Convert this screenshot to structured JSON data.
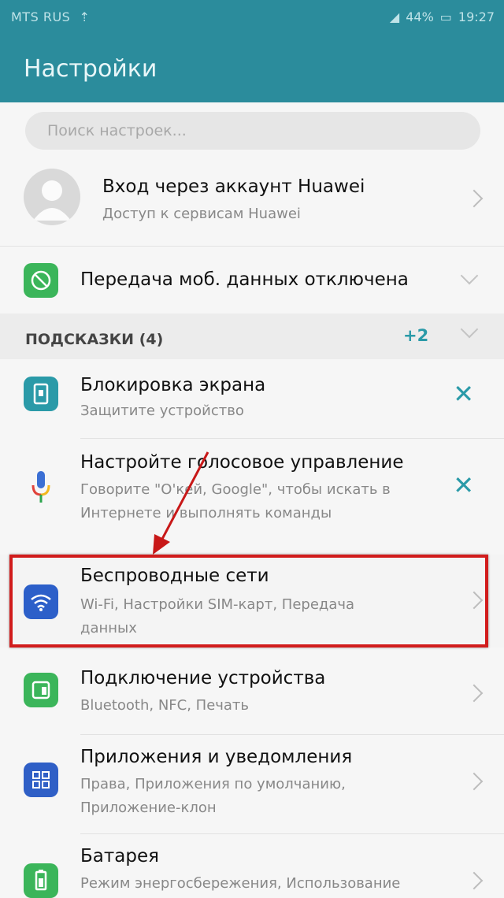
{
  "status": {
    "carrier": "MTS RUS",
    "battery": "44%",
    "time": "19:27"
  },
  "appbar": {
    "title": "Настройки"
  },
  "search": {
    "placeholder": "Поиск настроек..."
  },
  "account": {
    "title": "Вход через аккаунт Huawei",
    "subtitle": "Доступ к сервисам Huawei"
  },
  "mobile_data": {
    "title": "Передача моб. данных отключена"
  },
  "suggestions": {
    "header": "ПОДСКАЗКИ (4)",
    "more": "+2",
    "items": [
      {
        "title": "Блокировка экрана",
        "subtitle": "Защитите устройство",
        "icon": "lock-screen-icon",
        "dismiss": "✕"
      },
      {
        "title": "Настройте голосовое управление",
        "subtitle_line1": "Говорите \"О'кей, Google\", чтобы искать в",
        "subtitle_line2": "Интернете и выполнять команды",
        "icon": "microphone-icon",
        "dismiss": "✕"
      }
    ]
  },
  "settings": [
    {
      "title": "Беспроводные сети",
      "subtitle_line1": "Wi-Fi, Настройки SIM-карт, Передача",
      "subtitle_line2": "данных",
      "icon": "wifi-icon",
      "icon_color": "#2c5fc9"
    },
    {
      "title": "Подключение устройства",
      "subtitle_line1": "Bluetooth, NFC, Печать",
      "icon": "device-connect-icon",
      "icon_color": "#3bb55a"
    },
    {
      "title": "Приложения и уведомления",
      "subtitle_line1": "Права, Приложения по умолчанию,",
      "subtitle_line2": "Приложение-клон",
      "icon": "apps-icon",
      "icon_color": "#2f5fc6"
    },
    {
      "title": "Батарея",
      "subtitle_line1": "Режим энергосбережения, Использование",
      "icon": "battery-icon",
      "icon_color": "#3bb55a"
    }
  ],
  "colors": {
    "accent": "#2b8c9c",
    "teal": "#2a9aa8",
    "highlight": "#d11c1c"
  }
}
